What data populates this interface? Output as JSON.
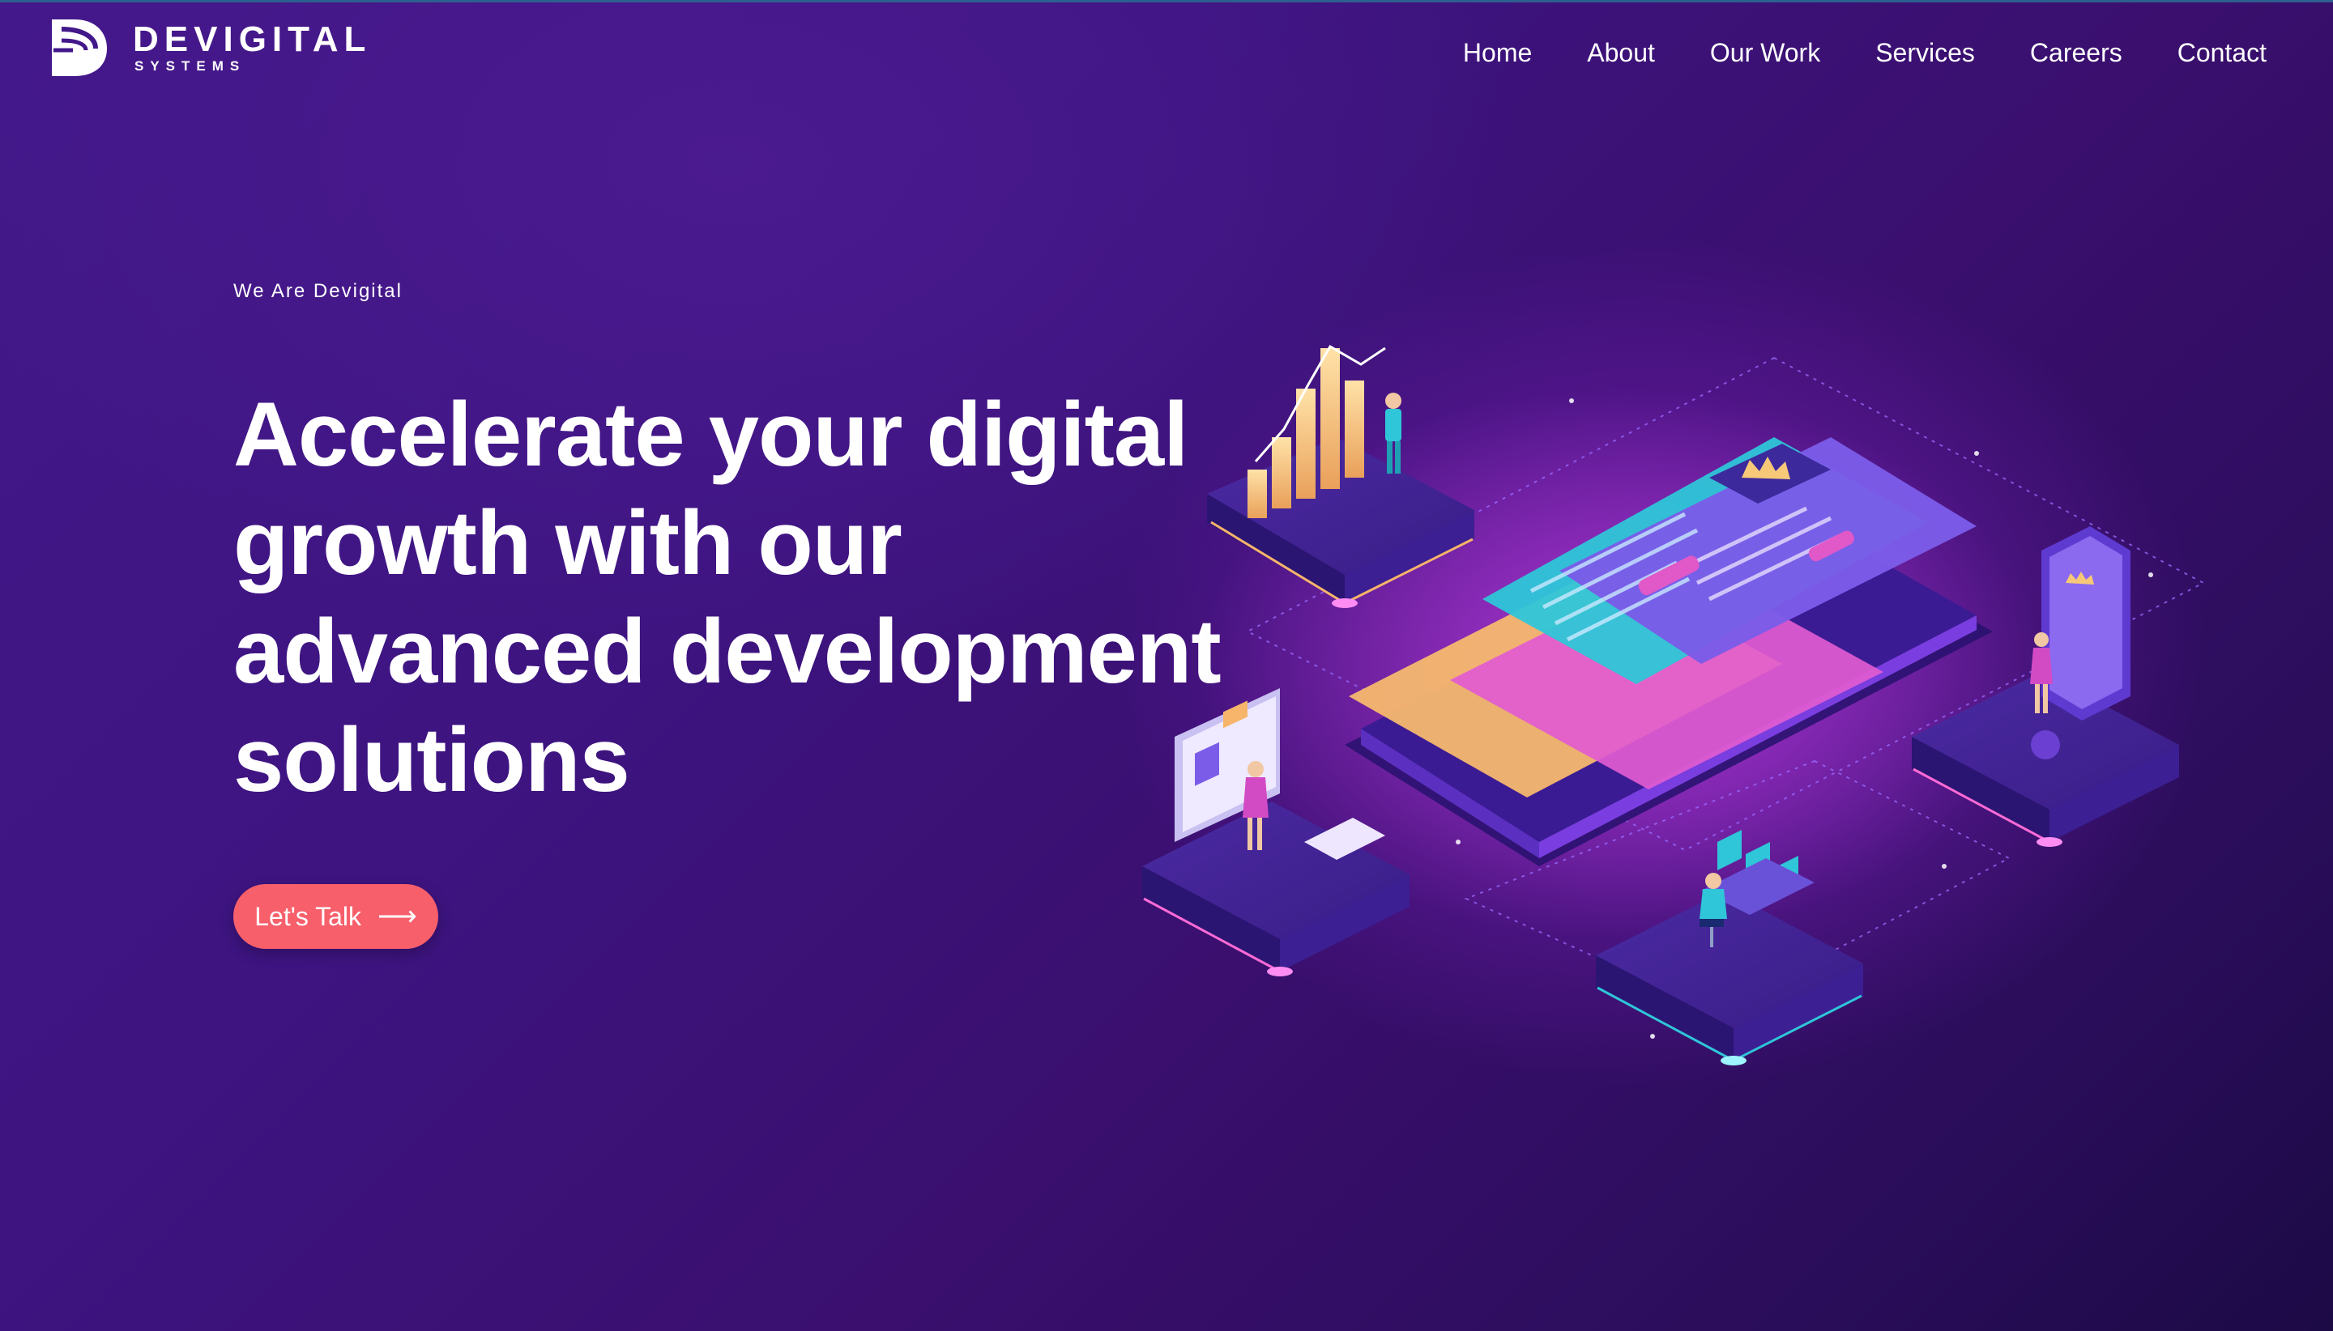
{
  "brand": {
    "name": "DEVIGITAL",
    "sub": "SYSTEMS"
  },
  "nav": {
    "items": [
      "Home",
      "About",
      "Our Work",
      "Services",
      "Careers",
      "Contact"
    ]
  },
  "hero": {
    "eyebrow": "We Are Devigital",
    "headline": "Accelerate your digital growth with our advanced development solutions",
    "cta_label": "Let's Talk",
    "cta_icon": "arrow-right-icon"
  },
  "colors": {
    "background": "#3d1480",
    "cta": "#f75f6b",
    "accent_pink": "#e04cd6",
    "accent_teal": "#2ec6d8",
    "accent_orange": "#f6b56a"
  }
}
